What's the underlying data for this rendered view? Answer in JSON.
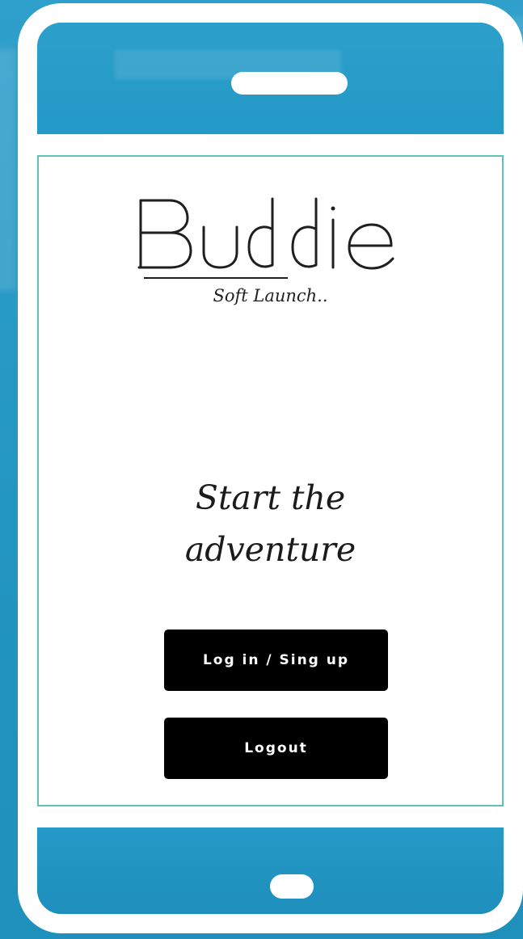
{
  "app": {
    "logo_text": "Buddie",
    "tagline": "Soft Launch..",
    "headline_line1": "Start the",
    "headline_line2": "adventure"
  },
  "buttons": {
    "login_label": "Log in / Sing up",
    "logout_label": "Logout"
  },
  "colors": {
    "background": "#2599c6",
    "device_frame": "#ffffff",
    "screen_border": "#5fc3b4",
    "button_bg": "#000000",
    "button_text": "#ffffff"
  }
}
